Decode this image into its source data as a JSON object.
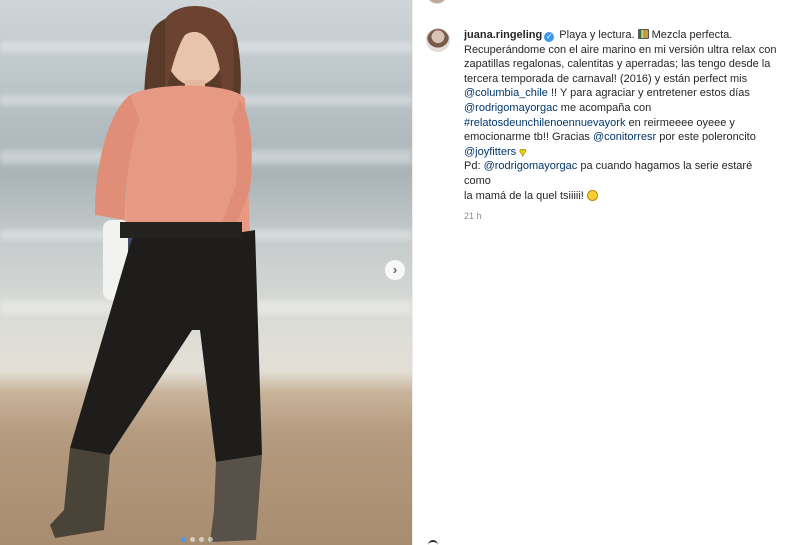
{
  "post": {
    "username": "juana.ringeling",
    "caption": {
      "line1_text": "Playa y lectura.",
      "line1_after": "Mezcla perfecta.",
      "line2": "Recuperándome con el aire marino en mi versión ultra relax con",
      "line3": "zapatillas regalonas, calentitas y aperradas; las tengo desde la",
      "line4": "tercera temporada de carnaval! (2016) y están perfect mis",
      "mention1": "@columbia_chile",
      "line5_after": "!! Y para agraciar y entretener estos días",
      "mention2": "@rodrigomayorgac",
      "line6_after": "me acompaña con",
      "hashtag1": "#relatosdeunchilenoennuevayork",
      "line7_after": "en reirmeeee oyeee y",
      "line8": "emocionarme tb!! Gracias",
      "mention3": "@conitorresr",
      "line8_after": "por este poleroncito",
      "mention4": "@joyfitters",
      "line10_before": "Pd:",
      "mention5": "@rodrigomayorgac",
      "line10_after": "pa cuando hagamos la serie estaré como",
      "line11": "la mamá de la quel tsiiiii!"
    },
    "timestamp": "21 h",
    "icons": {
      "verified": "verified-badge-icon",
      "book": "book-emoji-icon",
      "heart": "yellow-heart-emoji-icon",
      "smile": "grin-emoji-icon",
      "next": "chevron-right-icon"
    },
    "next_glyph": "›",
    "colors": {
      "link": "#00376b",
      "verified": "#3897f0",
      "text": "#262626",
      "meta": "#8e8e8e"
    }
  }
}
